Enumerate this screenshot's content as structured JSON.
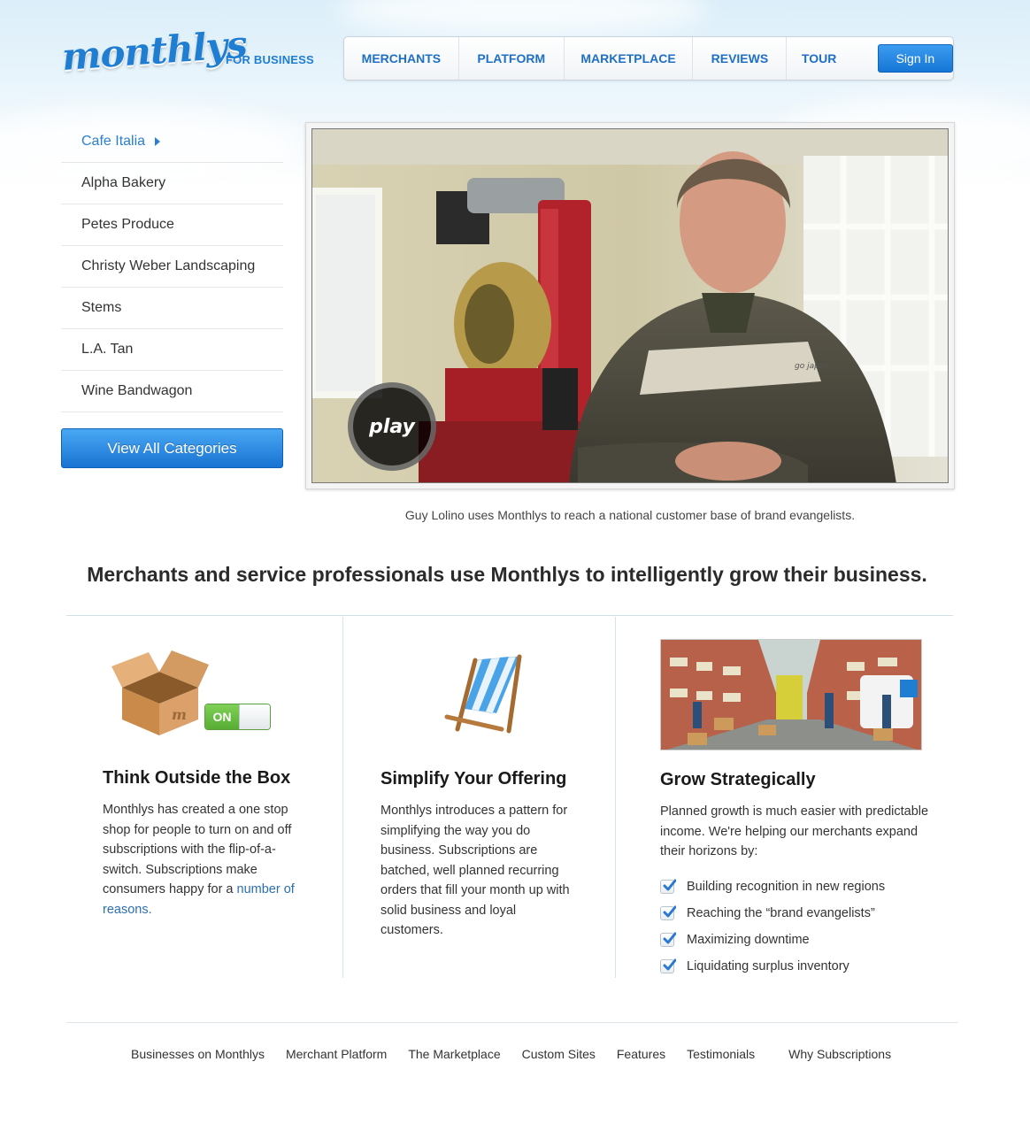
{
  "header": {
    "logo": "monthlys",
    "tagline": "FOR BUSINESS",
    "nav": [
      "MERCHANTS",
      "PLATFORM",
      "MARKETPLACE",
      "REVIEWS",
      "TOUR"
    ],
    "sign_in": "Sign In"
  },
  "sidebar": {
    "items": [
      {
        "label": "Cafe Italia",
        "active": true
      },
      {
        "label": "Alpha Bakery"
      },
      {
        "label": "Petes Produce"
      },
      {
        "label": "Christy Weber Landscaping"
      },
      {
        "label": "Stems"
      },
      {
        "label": "L.A. Tan"
      },
      {
        "label": "Wine Bandwagon"
      }
    ],
    "view_all": "View All Categories"
  },
  "video": {
    "play_label": "play",
    "shirt_text": "go japan",
    "caption": "Guy Lolino uses Monthlys to reach a national customer base of brand evangelists."
  },
  "headline": "Merchants and service professionals use Monthlys to intelligently grow their business.",
  "features": {
    "box": {
      "toggle": "ON",
      "box_mark": "m",
      "title": "Think Outside the Box",
      "body": "Monthlys has created a one stop shop for people to turn on and off subscriptions with the flip-of-a-switch. Subscriptions make consumers happy for a",
      "link": "number of reasons."
    },
    "simplify": {
      "title": "Simplify Your Offering",
      "body": "Monthlys introduces a pattern for simplifying the way you do business. Subscriptions are batched, well planned recurring orders that fill your month up with solid business and loyal customers."
    },
    "grow": {
      "title": "Grow Strategically",
      "body": "Planned growth is much easier with predictable income. We're helping our merchants expand their horizons by:",
      "checklist": [
        "Building recognition in new regions",
        "Reaching the “brand evangelists”",
        "Maximizing downtime",
        "Liquidating surplus inventory"
      ]
    }
  },
  "footer": [
    "Businesses on Monthlys",
    "Merchant Platform",
    "The Marketplace",
    "Custom Sites",
    "Features",
    "Testimonials",
    "Why Subscriptions"
  ],
  "colors": {
    "brand_blue": "#1f7ed2",
    "button_blue": "#1973d3",
    "toggle_green": "#6cc04a"
  }
}
